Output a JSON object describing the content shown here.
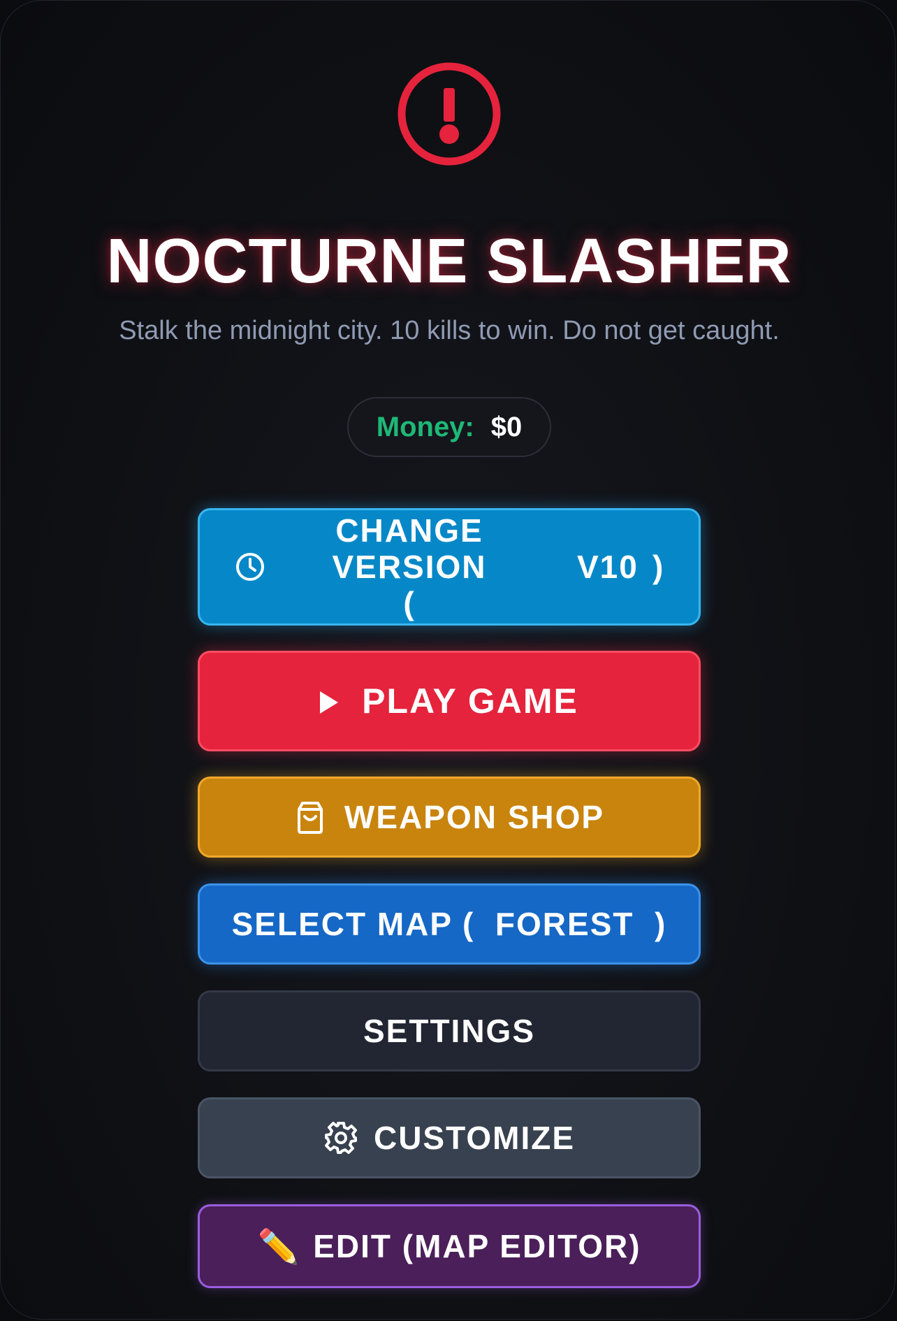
{
  "game": {
    "title": "NOCTURNE SLASHER",
    "subtitle": "Stalk the midnight city. 10 kills to win. Do not get caught."
  },
  "hud": {
    "money_label": "Money:",
    "money_value": "$0"
  },
  "menu": {
    "change_version_label": "CHANGE VERSION (",
    "version_value": "V10",
    "version_close": ")",
    "play_label": "PLAY GAME",
    "shop_label": "WEAPON SHOP",
    "select_map_label": "SELECT MAP (  FOREST  )",
    "settings_label": "SETTINGS",
    "customize_label": "CUSTOMIZE",
    "edit_label": "EDIT (MAP EDITOR)",
    "edit_icon": "✏️"
  },
  "icons": {
    "alert": "alert-circle-icon",
    "version": "clock-icon",
    "play": "play-icon",
    "shop": "shopping-bag-icon",
    "customize": "gear-icon",
    "edit": "pencil-icon"
  },
  "colors": {
    "accent_red": "#e5233c",
    "version_blue": "#0688c8",
    "shop_gold": "#c9840e",
    "map_blue": "#1668c6",
    "settings_dark": "#222633",
    "customize_slate": "#38414f",
    "edit_purple": "#4b1f5a",
    "money_green": "#1fb877"
  }
}
